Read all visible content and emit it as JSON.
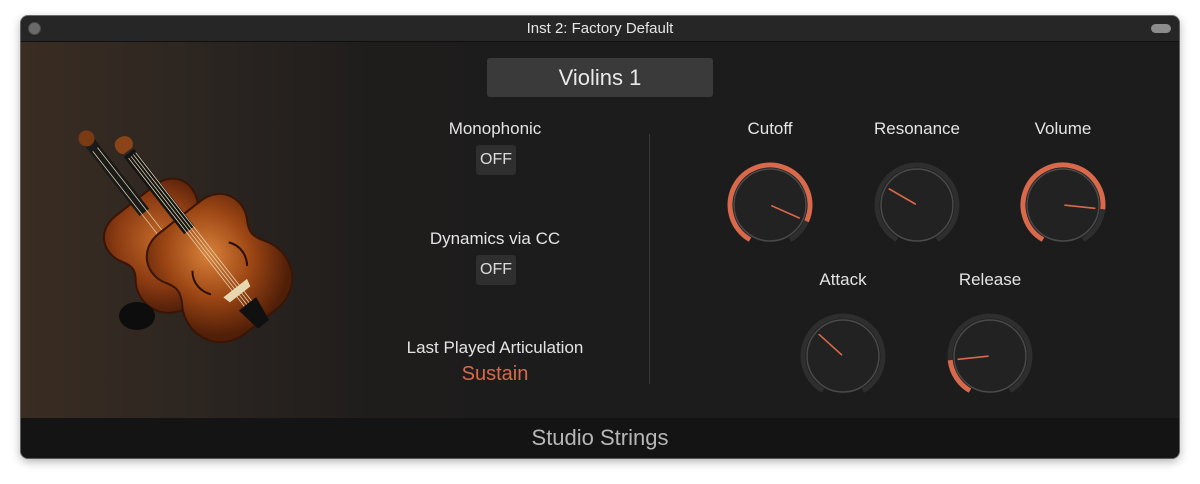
{
  "window": {
    "title": "Inst 2: Factory Default"
  },
  "preset": {
    "name": "Violins 1"
  },
  "params": {
    "monophonic": {
      "label": "Monophonic",
      "value": "OFF"
    },
    "dynamics": {
      "label": "Dynamics via CC",
      "value": "OFF"
    },
    "articulation": {
      "label": "Last Played Articulation",
      "value": "Sustain"
    }
  },
  "knobs": [
    {
      "id": "cutoff",
      "label": "Cutoff",
      "value": 0.88
    },
    {
      "id": "resonance",
      "label": "Resonance",
      "value": 0.3
    },
    {
      "id": "volume",
      "label": "Volume",
      "value": 0.82
    },
    {
      "id": "attack",
      "label": "Attack",
      "value": 0.34
    },
    {
      "id": "release",
      "label": "Release",
      "value": 0.18
    }
  ],
  "colors": {
    "accent": "#d9694a",
    "knob_track": "#2e2e2e",
    "knob_body": "#222222"
  },
  "footer": {
    "product": "Studio Strings"
  }
}
